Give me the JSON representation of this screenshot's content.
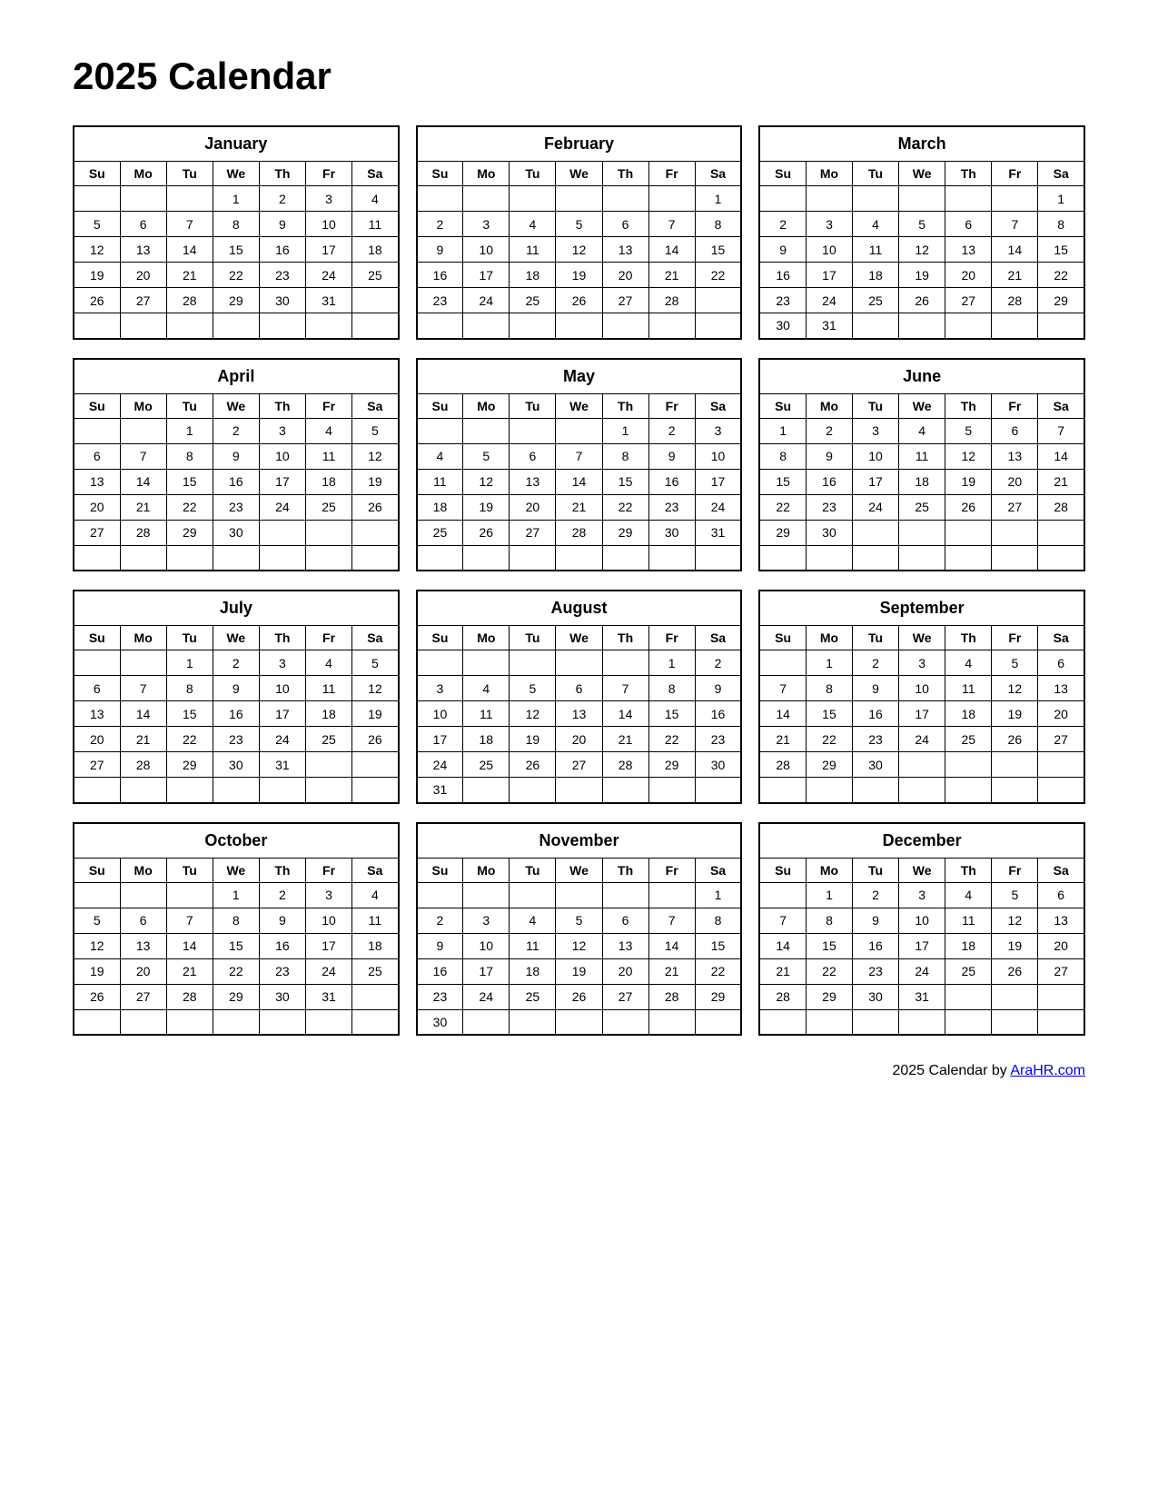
{
  "title": "2025 Calendar",
  "footer": {
    "text": "2025  Calendar by ",
    "link_text": "AraHR.com",
    "link_url": "AraHR.com"
  },
  "months": [
    {
      "name": "January",
      "days": [
        "Su",
        "Mo",
        "Tu",
        "We",
        "Th",
        "Fr",
        "Sa"
      ],
      "weeks": [
        [
          "",
          "",
          "",
          "1",
          "2",
          "3",
          "4"
        ],
        [
          "5",
          "6",
          "7",
          "8",
          "9",
          "10",
          "11"
        ],
        [
          "12",
          "13",
          "14",
          "15",
          "16",
          "17",
          "18"
        ],
        [
          "19",
          "20",
          "21",
          "22",
          "23",
          "24",
          "25"
        ],
        [
          "26",
          "27",
          "28",
          "29",
          "30",
          "31",
          ""
        ],
        [
          "",
          "",
          "",
          "",
          "",
          "",
          ""
        ]
      ]
    },
    {
      "name": "February",
      "days": [
        "Su",
        "Mo",
        "Tu",
        "We",
        "Th",
        "Fr",
        "Sa"
      ],
      "weeks": [
        [
          "",
          "",
          "",
          "",
          "",
          "",
          "1"
        ],
        [
          "2",
          "3",
          "4",
          "5",
          "6",
          "7",
          "8"
        ],
        [
          "9",
          "10",
          "11",
          "12",
          "13",
          "14",
          "15"
        ],
        [
          "16",
          "17",
          "18",
          "19",
          "20",
          "21",
          "22"
        ],
        [
          "23",
          "24",
          "25",
          "26",
          "27",
          "28",
          ""
        ],
        [
          "",
          "",
          "",
          "",
          "",
          "",
          ""
        ]
      ]
    },
    {
      "name": "March",
      "days": [
        "Su",
        "Mo",
        "Tu",
        "We",
        "Th",
        "Fr",
        "Sa"
      ],
      "weeks": [
        [
          "",
          "",
          "",
          "",
          "",
          "",
          "1"
        ],
        [
          "2",
          "3",
          "4",
          "5",
          "6",
          "7",
          "8"
        ],
        [
          "9",
          "10",
          "11",
          "12",
          "13",
          "14",
          "15"
        ],
        [
          "16",
          "17",
          "18",
          "19",
          "20",
          "21",
          "22"
        ],
        [
          "23",
          "24",
          "25",
          "26",
          "27",
          "28",
          "29"
        ],
        [
          "30",
          "31",
          "",
          "",
          "",
          "",
          ""
        ]
      ]
    },
    {
      "name": "April",
      "days": [
        "Su",
        "Mo",
        "Tu",
        "We",
        "Th",
        "Fr",
        "Sa"
      ],
      "weeks": [
        [
          "",
          "",
          "1",
          "2",
          "3",
          "4",
          "5"
        ],
        [
          "6",
          "7",
          "8",
          "9",
          "10",
          "11",
          "12"
        ],
        [
          "13",
          "14",
          "15",
          "16",
          "17",
          "18",
          "19"
        ],
        [
          "20",
          "21",
          "22",
          "23",
          "24",
          "25",
          "26"
        ],
        [
          "27",
          "28",
          "29",
          "30",
          "",
          "",
          ""
        ],
        [
          "",
          "",
          "",
          "",
          "",
          "",
          ""
        ]
      ]
    },
    {
      "name": "May",
      "days": [
        "Su",
        "Mo",
        "Tu",
        "We",
        "Th",
        "Fr",
        "Sa"
      ],
      "weeks": [
        [
          "",
          "",
          "",
          "",
          "1",
          "2",
          "3"
        ],
        [
          "4",
          "5",
          "6",
          "7",
          "8",
          "9",
          "10"
        ],
        [
          "11",
          "12",
          "13",
          "14",
          "15",
          "16",
          "17"
        ],
        [
          "18",
          "19",
          "20",
          "21",
          "22",
          "23",
          "24"
        ],
        [
          "25",
          "26",
          "27",
          "28",
          "29",
          "30",
          "31"
        ],
        [
          "",
          "",
          "",
          "",
          "",
          "",
          ""
        ]
      ]
    },
    {
      "name": "June",
      "days": [
        "Su",
        "Mo",
        "Tu",
        "We",
        "Th",
        "Fr",
        "Sa"
      ],
      "weeks": [
        [
          "1",
          "2",
          "3",
          "4",
          "5",
          "6",
          "7"
        ],
        [
          "8",
          "9",
          "10",
          "11",
          "12",
          "13",
          "14"
        ],
        [
          "15",
          "16",
          "17",
          "18",
          "19",
          "20",
          "21"
        ],
        [
          "22",
          "23",
          "24",
          "25",
          "26",
          "27",
          "28"
        ],
        [
          "29",
          "30",
          "",
          "",
          "",
          "",
          ""
        ],
        [
          "",
          "",
          "",
          "",
          "",
          "",
          ""
        ]
      ]
    },
    {
      "name": "July",
      "days": [
        "Su",
        "Mo",
        "Tu",
        "We",
        "Th",
        "Fr",
        "Sa"
      ],
      "weeks": [
        [
          "",
          "",
          "1",
          "2",
          "3",
          "4",
          "5"
        ],
        [
          "6",
          "7",
          "8",
          "9",
          "10",
          "11",
          "12"
        ],
        [
          "13",
          "14",
          "15",
          "16",
          "17",
          "18",
          "19"
        ],
        [
          "20",
          "21",
          "22",
          "23",
          "24",
          "25",
          "26"
        ],
        [
          "27",
          "28",
          "29",
          "30",
          "31",
          "",
          ""
        ],
        [
          "",
          "",
          "",
          "",
          "",
          "",
          ""
        ]
      ]
    },
    {
      "name": "August",
      "days": [
        "Su",
        "Mo",
        "Tu",
        "We",
        "Th",
        "Fr",
        "Sa"
      ],
      "weeks": [
        [
          "",
          "",
          "",
          "",
          "",
          "1",
          "2"
        ],
        [
          "3",
          "4",
          "5",
          "6",
          "7",
          "8",
          "9"
        ],
        [
          "10",
          "11",
          "12",
          "13",
          "14",
          "15",
          "16"
        ],
        [
          "17",
          "18",
          "19",
          "20",
          "21",
          "22",
          "23"
        ],
        [
          "24",
          "25",
          "26",
          "27",
          "28",
          "29",
          "30"
        ],
        [
          "31",
          "",
          "",
          "",
          "",
          "",
          ""
        ]
      ]
    },
    {
      "name": "September",
      "days": [
        "Su",
        "Mo",
        "Tu",
        "We",
        "Th",
        "Fr",
        "Sa"
      ],
      "weeks": [
        [
          "",
          "1",
          "2",
          "3",
          "4",
          "5",
          "6"
        ],
        [
          "7",
          "8",
          "9",
          "10",
          "11",
          "12",
          "13"
        ],
        [
          "14",
          "15",
          "16",
          "17",
          "18",
          "19",
          "20"
        ],
        [
          "21",
          "22",
          "23",
          "24",
          "25",
          "26",
          "27"
        ],
        [
          "28",
          "29",
          "30",
          "",
          "",
          "",
          ""
        ],
        [
          "",
          "",
          "",
          "",
          "",
          "",
          ""
        ]
      ]
    },
    {
      "name": "October",
      "days": [
        "Su",
        "Mo",
        "Tu",
        "We",
        "Th",
        "Fr",
        "Sa"
      ],
      "weeks": [
        [
          "",
          "",
          "",
          "1",
          "2",
          "3",
          "4"
        ],
        [
          "5",
          "6",
          "7",
          "8",
          "9",
          "10",
          "11"
        ],
        [
          "12",
          "13",
          "14",
          "15",
          "16",
          "17",
          "18"
        ],
        [
          "19",
          "20",
          "21",
          "22",
          "23",
          "24",
          "25"
        ],
        [
          "26",
          "27",
          "28",
          "29",
          "30",
          "31",
          ""
        ],
        [
          "",
          "",
          "",
          "",
          "",
          "",
          ""
        ]
      ]
    },
    {
      "name": "November",
      "days": [
        "Su",
        "Mo",
        "Tu",
        "We",
        "Th",
        "Fr",
        "Sa"
      ],
      "weeks": [
        [
          "",
          "",
          "",
          "",
          "",
          "",
          "1"
        ],
        [
          "2",
          "3",
          "4",
          "5",
          "6",
          "7",
          "8"
        ],
        [
          "9",
          "10",
          "11",
          "12",
          "13",
          "14",
          "15"
        ],
        [
          "16",
          "17",
          "18",
          "19",
          "20",
          "21",
          "22"
        ],
        [
          "23",
          "24",
          "25",
          "26",
          "27",
          "28",
          "29"
        ],
        [
          "30",
          "",
          "",
          "",
          "",
          "",
          ""
        ]
      ]
    },
    {
      "name": "December",
      "days": [
        "Su",
        "Mo",
        "Tu",
        "We",
        "Th",
        "Fr",
        "Sa"
      ],
      "weeks": [
        [
          "",
          "1",
          "2",
          "3",
          "4",
          "5",
          "6"
        ],
        [
          "7",
          "8",
          "9",
          "10",
          "11",
          "12",
          "13"
        ],
        [
          "14",
          "15",
          "16",
          "17",
          "18",
          "19",
          "20"
        ],
        [
          "21",
          "22",
          "23",
          "24",
          "25",
          "26",
          "27"
        ],
        [
          "28",
          "29",
          "30",
          "31",
          "",
          "",
          ""
        ],
        [
          "",
          "",
          "",
          "",
          "",
          "",
          ""
        ]
      ]
    }
  ]
}
